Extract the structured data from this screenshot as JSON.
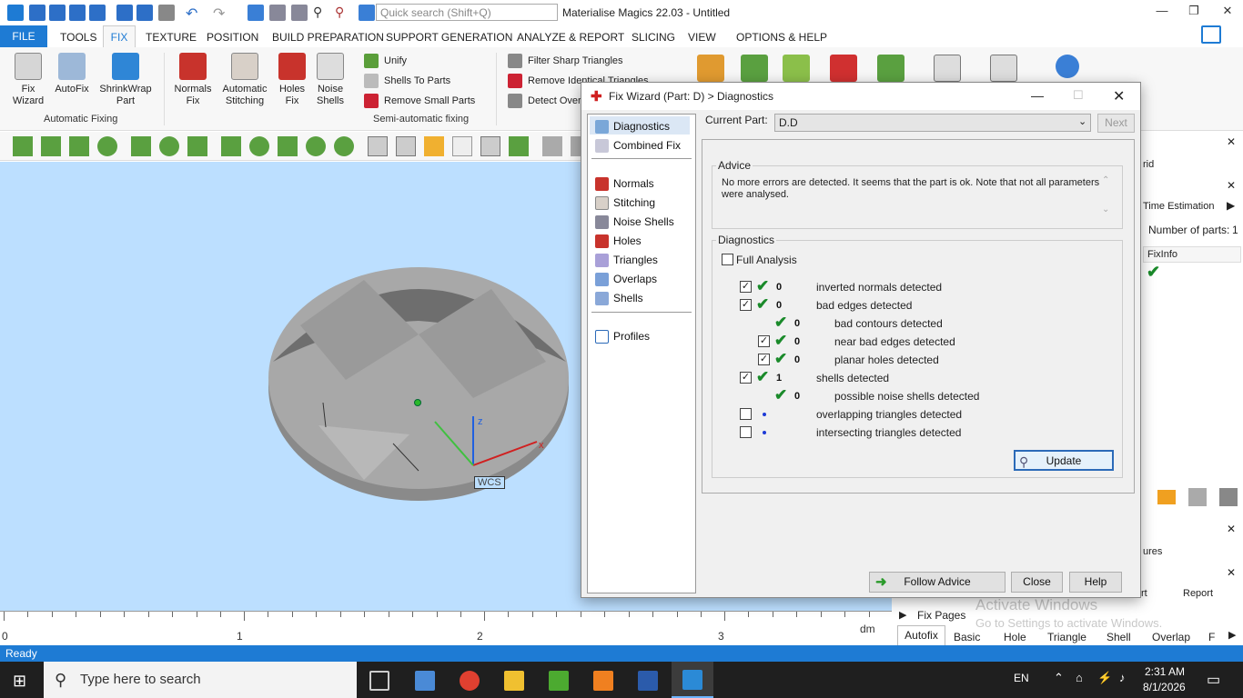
{
  "app": {
    "title": "Materialise Magics 22.03 - Untitled",
    "search_placeholder": "Quick search (Shift+Q)"
  },
  "menu": [
    "FILE",
    "TOOLS",
    "FIX",
    "TEXTURE",
    "POSITION",
    "BUILD PREPARATION",
    "SUPPORT GENERATION",
    "ANALYZE & REPORT",
    "SLICING",
    "VIEW",
    "OPTIONS & HELP"
  ],
  "ribbon": {
    "auto": [
      {
        "label": "Fix\nWizard"
      },
      {
        "label": "AutoFix"
      },
      {
        "label": "ShrinkWrap\nPart"
      }
    ],
    "auto_group": "Automatic Fixing",
    "semi": [
      {
        "label": "Normals\nFix"
      },
      {
        "label": "Automatic\nStitching"
      },
      {
        "label": "Holes\nFix"
      },
      {
        "label": "Noise\nShells"
      }
    ],
    "semi_small": [
      "Unify",
      "Shells To Parts",
      "Remove Small Parts"
    ],
    "semi_group": "Semi-automatic fixing",
    "tri_small": [
      "Filter Sharp Triangles",
      "Remove Identical Triangles",
      "Detect Overl"
    ]
  },
  "viewport": {
    "axis_z": "z",
    "axis_x": "x",
    "wcs": "WCS",
    "ruler": [
      "0",
      "1",
      "2",
      "3"
    ],
    "ruler_unit": "dm"
  },
  "right": {
    "item_grid": "rid",
    "time": "Time Estimation",
    "num_parts": "Number of parts:",
    "num_value": "1",
    "fixinfo": "FixInfo",
    "features": "ures",
    "rt": "rt",
    "report": "Report",
    "fix_pages": "Fix Pages",
    "tabs": [
      "Autofix",
      "Basic",
      "Hole",
      "Triangle",
      "Shell",
      "Overlap",
      "F"
    ],
    "watermark1": "Activate Windows",
    "watermark2": "Go to Settings to activate Windows."
  },
  "status": "Ready",
  "taskbar": {
    "search": "Type here to search",
    "lang": "EN",
    "time": "2:31 AM",
    "date": "8/1/2026"
  },
  "dialog": {
    "title": "Fix Wizard (Part: D) > Diagnostics",
    "nav": [
      "Diagnostics",
      "Combined Fix",
      "Normals",
      "Stitching",
      "Noise Shells",
      "Holes",
      "Triangles",
      "Overlaps",
      "Shells",
      "Profiles"
    ],
    "current_part_label": "Current Part:",
    "current_part": "D.D",
    "next": "Next",
    "advice_legend": "Advice",
    "advice_text": "No more errors are detected. It seems that the part is ok. Note that not all parameters were analysed.",
    "diag_legend": "Diagnostics",
    "full_analysis": "Full Analysis",
    "rows": [
      {
        "num": "0",
        "text": "inverted normals detected"
      },
      {
        "num": "0",
        "text": "bad edges detected"
      },
      {
        "num": "0",
        "text": "bad contours detected"
      },
      {
        "num": "0",
        "text": "near bad edges detected"
      },
      {
        "num": "0",
        "text": "planar holes detected"
      },
      {
        "num": "1",
        "text": "shells detected"
      },
      {
        "num": "0",
        "text": "possible noise shells detected"
      },
      {
        "num": "",
        "text": "overlapping triangles detected"
      },
      {
        "num": "",
        "text": "intersecting triangles detected"
      }
    ],
    "update": "Update",
    "follow": "Follow Advice",
    "close": "Close",
    "help": "Help"
  },
  "colors": {
    "accent": "#1e7bd4",
    "check": "#1a8a2a",
    "viewport": "#bcdfff"
  }
}
